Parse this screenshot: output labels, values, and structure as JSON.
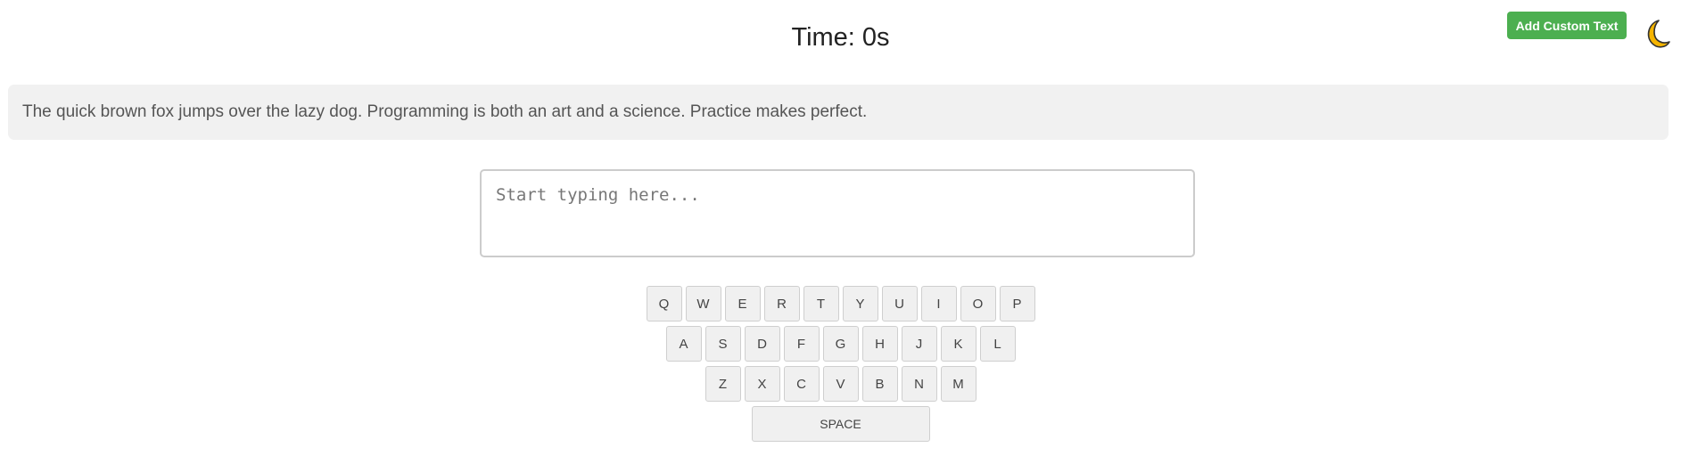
{
  "timer": {
    "text": "Time: 0s"
  },
  "header": {
    "custom_text_button": "Add Custom Text",
    "theme_toggle_icon": "moon-icon",
    "theme_toggle_color": "#f5b400"
  },
  "sample": {
    "text": "The quick brown fox jumps over the lazy dog. Programming is both an art and a science. Practice makes perfect."
  },
  "input": {
    "value": "",
    "placeholder": "Start typing here..."
  },
  "keyboard": {
    "rows": [
      [
        "Q",
        "W",
        "E",
        "R",
        "T",
        "Y",
        "U",
        "I",
        "O",
        "P"
      ],
      [
        "A",
        "S",
        "D",
        "F",
        "G",
        "H",
        "J",
        "K",
        "L"
      ],
      [
        "Z",
        "X",
        "C",
        "V",
        "B",
        "N",
        "M"
      ]
    ],
    "space_label": "SPACE"
  },
  "colors": {
    "accent": "#4caf50",
    "sample_bg": "#f1f1f1",
    "key_bg": "#f0f0f0"
  }
}
